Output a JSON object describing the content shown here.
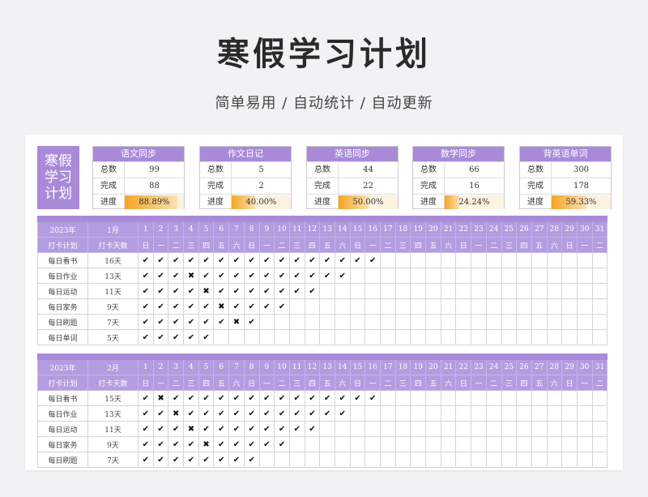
{
  "title": "寒假学习计划",
  "subtitle": "简单易用  /  自动统计  /  自动更新",
  "main_label": "寒假学习计划",
  "summaries": [
    {
      "name": "语文同步",
      "total_label": "总数",
      "total": "99",
      "done_label": "完成",
      "done": "88",
      "progress_label": "进度",
      "progress": "88.89%",
      "progress_value": 0.8889
    },
    {
      "name": "作文日记",
      "total_label": "总数",
      "total": "5",
      "done_label": "完成",
      "done": "2",
      "progress_label": "进度",
      "progress": "40.00%",
      "progress_value": 0.4
    },
    {
      "name": "英语同步",
      "total_label": "总数",
      "total": "44",
      "done_label": "完成",
      "done": "22",
      "progress_label": "进度",
      "progress": "50.00%",
      "progress_value": 0.5
    },
    {
      "name": "数学同步",
      "total_label": "总数",
      "total": "66",
      "done_label": "完成",
      "done": "16",
      "progress_label": "进度",
      "progress": "24.24%",
      "progress_value": 0.2424
    },
    {
      "name": "背英语单词",
      "total_label": "总数",
      "total": "300",
      "done_label": "完成",
      "done": "178",
      "progress_label": "进度",
      "progress": "59.33%",
      "progress_value": 0.5933
    }
  ],
  "calendars": [
    {
      "year": "2023年",
      "month": "1月",
      "col1": "打卡计划",
      "col2": "打卡天数",
      "days": [
        "1",
        "2",
        "3",
        "4",
        "5",
        "6",
        "7",
        "8",
        "9",
        "10",
        "11",
        "12",
        "13",
        "14",
        "15",
        "16",
        "17",
        "18",
        "19",
        "20",
        "21",
        "22",
        "23",
        "24",
        "25",
        "26",
        "27",
        "28",
        "29",
        "30",
        "31"
      ],
      "weekdays": [
        "日",
        "一",
        "二",
        "三",
        "四",
        "五",
        "六",
        "日",
        "一",
        "二",
        "三",
        "四",
        "五",
        "六",
        "日",
        "一",
        "二",
        "三",
        "四",
        "五",
        "六",
        "日",
        "一",
        "二",
        "三",
        "四",
        "五",
        "六",
        "日",
        "一",
        "二"
      ],
      "rows": [
        {
          "name": "每日看书",
          "count": "16天",
          "marks": [
            "v",
            "c",
            "c",
            "c",
            "c",
            "c",
            "c",
            "c",
            "c",
            "c",
            "c",
            "c",
            "c",
            "c",
            "c",
            "c"
          ]
        },
        {
          "name": "每日作业",
          "count": "13天",
          "marks": [
            "c",
            "c",
            "c",
            "x",
            "c",
            "c",
            "c",
            "c",
            "c",
            "c",
            "c",
            "c",
            "c",
            "c"
          ]
        },
        {
          "name": "每日运动",
          "count": "11天",
          "marks": [
            "c",
            "c",
            "c",
            "c",
            "x",
            "c",
            "c",
            "c",
            "c",
            "c",
            "c",
            "c"
          ]
        },
        {
          "name": "每日家务",
          "count": "9天",
          "marks": [
            "c",
            "c",
            "c",
            "c",
            "c",
            "x",
            "c",
            "c",
            "c",
            "c"
          ]
        },
        {
          "name": "每日刷题",
          "count": "7天",
          "marks": [
            "c",
            "c",
            "c",
            "c",
            "c",
            "c",
            "x",
            "c"
          ]
        },
        {
          "name": "每日单词",
          "count": "5天",
          "marks": [
            "c",
            "c",
            "c",
            "c",
            "c"
          ]
        }
      ]
    },
    {
      "year": "2023年",
      "month": "2月",
      "col1": "打卡计划",
      "col2": "打卡天数",
      "days": [
        "1",
        "2",
        "3",
        "4",
        "5",
        "6",
        "7",
        "8",
        "9",
        "10",
        "11",
        "12",
        "13",
        "14",
        "15",
        "16",
        "17",
        "18",
        "19",
        "20",
        "21",
        "22",
        "23",
        "24",
        "25",
        "26",
        "27",
        "28",
        "29",
        "30",
        "31"
      ],
      "weekdays": [
        "日",
        "一",
        "二",
        "三",
        "四",
        "五",
        "六",
        "日",
        "一",
        "二",
        "三",
        "四",
        "五",
        "六",
        "日",
        "一",
        "二",
        "三",
        "四",
        "五",
        "六",
        "日",
        "一",
        "二",
        "三",
        "四",
        "五",
        "六",
        "日",
        "一",
        "二"
      ],
      "rows": [
        {
          "name": "每日看书",
          "count": "15天",
          "marks": [
            "c",
            "x",
            "c",
            "c",
            "c",
            "c",
            "c",
            "c",
            "c",
            "c",
            "c",
            "c",
            "c",
            "c",
            "c",
            "c"
          ]
        },
        {
          "name": "每日作业",
          "count": "13天",
          "marks": [
            "c",
            "c",
            "x",
            "c",
            "c",
            "c",
            "c",
            "c",
            "c",
            "c",
            "c",
            "c",
            "c",
            "c"
          ]
        },
        {
          "name": "每日运动",
          "count": "11天",
          "marks": [
            "c",
            "c",
            "c",
            "x",
            "c",
            "c",
            "c",
            "c",
            "c",
            "c",
            "c",
            "c"
          ]
        },
        {
          "name": "每日家务",
          "count": "9天",
          "marks": [
            "c",
            "c",
            "c",
            "c",
            "x",
            "c",
            "c",
            "c",
            "c",
            "c"
          ]
        },
        {
          "name": "每日刷题",
          "count": "7天",
          "marks": [
            "c",
            "c",
            "c",
            "c",
            "c",
            "c",
            "c",
            "c"
          ]
        }
      ]
    }
  ],
  "glyphs": {
    "c": "✔",
    "x": "✖",
    "v": "✔"
  },
  "colors": {
    "accent": "#a98ad8",
    "progress": "#f5a623"
  }
}
